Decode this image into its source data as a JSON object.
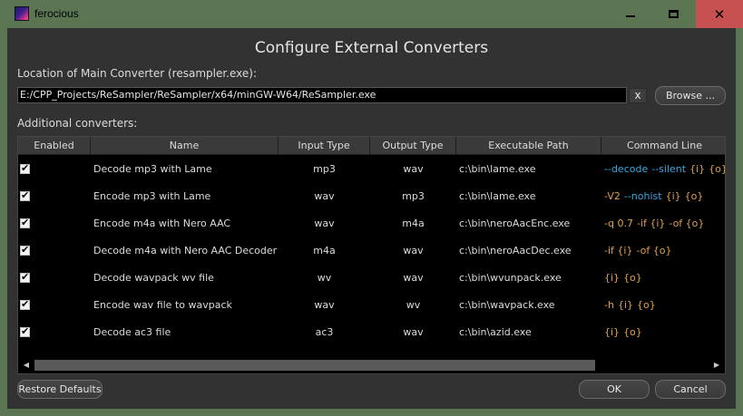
{
  "window": {
    "title": "ferocious",
    "minimize_icon": "minimize-icon",
    "maximize_icon": "maximize-icon",
    "close_glyph": "✕"
  },
  "dialog": {
    "heading": "Configure External Converters",
    "main_converter_label": "Location of Main Converter (resampler.exe):",
    "main_converter_path": "E:/CPP_Projects/ReSampler/ReSampler/x64/minGW-W64/ReSampler.exe",
    "clear_label": "x",
    "browse_label": "Browse ...",
    "additional_label": "Additional converters:",
    "restore_defaults_label": "Restore Defaults",
    "ok_label": "OK",
    "cancel_label": "Cancel"
  },
  "table": {
    "columns": [
      "Enabled",
      "Name",
      "Input Type",
      "Output Type",
      "Executable Path",
      "Command Line"
    ],
    "rows": [
      {
        "enabled": true,
        "name": "Decode mp3 with Lame",
        "input": "mp3",
        "output": "wav",
        "path": "c:\\bin\\lame.exe",
        "cmd": [
          {
            "t": "--decode",
            "c": "blue"
          },
          {
            "t": "--silent",
            "c": "blue"
          },
          {
            "t": "{i}",
            "c": "orange"
          },
          {
            "t": "{o}",
            "c": "orange"
          }
        ]
      },
      {
        "enabled": true,
        "name": "Encode mp3 with Lame",
        "input": "wav",
        "output": "mp3",
        "path": "c:\\bin\\lame.exe",
        "cmd": [
          {
            "t": "-V2",
            "c": "orange"
          },
          {
            "t": "--nohist",
            "c": "blue"
          },
          {
            "t": "{i}",
            "c": "orange"
          },
          {
            "t": "{o}",
            "c": "orange"
          }
        ]
      },
      {
        "enabled": true,
        "name": "Encode m4a with Nero AAC",
        "input": "wav",
        "output": "m4a",
        "path": "c:\\bin\\neroAacEnc.exe",
        "cmd": [
          {
            "t": "-q 0.7",
            "c": "orange"
          },
          {
            "t": "-if {i}",
            "c": "orange"
          },
          {
            "t": "-of {o}",
            "c": "orange"
          }
        ]
      },
      {
        "enabled": true,
        "name": "Decode m4a with Nero AAC Decoder",
        "input": "m4a",
        "output": "wav",
        "path": "c:\\bin\\neroAacDec.exe",
        "cmd": [
          {
            "t": "-if {i}",
            "c": "orange"
          },
          {
            "t": "-of {o}",
            "c": "orange"
          }
        ]
      },
      {
        "enabled": true,
        "name": "Decode wavpack wv file",
        "input": "wv",
        "output": "wav",
        "path": "c:\\bin\\wvunpack.exe",
        "cmd": [
          {
            "t": "{i}",
            "c": "orange"
          },
          {
            "t": "{o}",
            "c": "orange"
          }
        ]
      },
      {
        "enabled": true,
        "name": "Encode wav file to wavpack",
        "input": "wav",
        "output": "wv",
        "path": "c:\\bin\\wavpack.exe",
        "cmd": [
          {
            "t": "-h",
            "c": "orange"
          },
          {
            "t": "{i}",
            "c": "orange"
          },
          {
            "t": "{o}",
            "c": "orange"
          }
        ]
      },
      {
        "enabled": true,
        "name": "Decode ac3 file",
        "input": "ac3",
        "output": "wav",
        "path": "c:\\bin\\azid.exe",
        "cmd": [
          {
            "t": "{i}",
            "c": "orange"
          },
          {
            "t": "{o}",
            "c": "orange"
          }
        ]
      }
    ]
  },
  "colors": {
    "titlebar": "#5b7553",
    "close_hover": "#c75050",
    "client": "#323232",
    "flag_blue": "#3aa8e0",
    "flag_orange": "#e0a050"
  }
}
